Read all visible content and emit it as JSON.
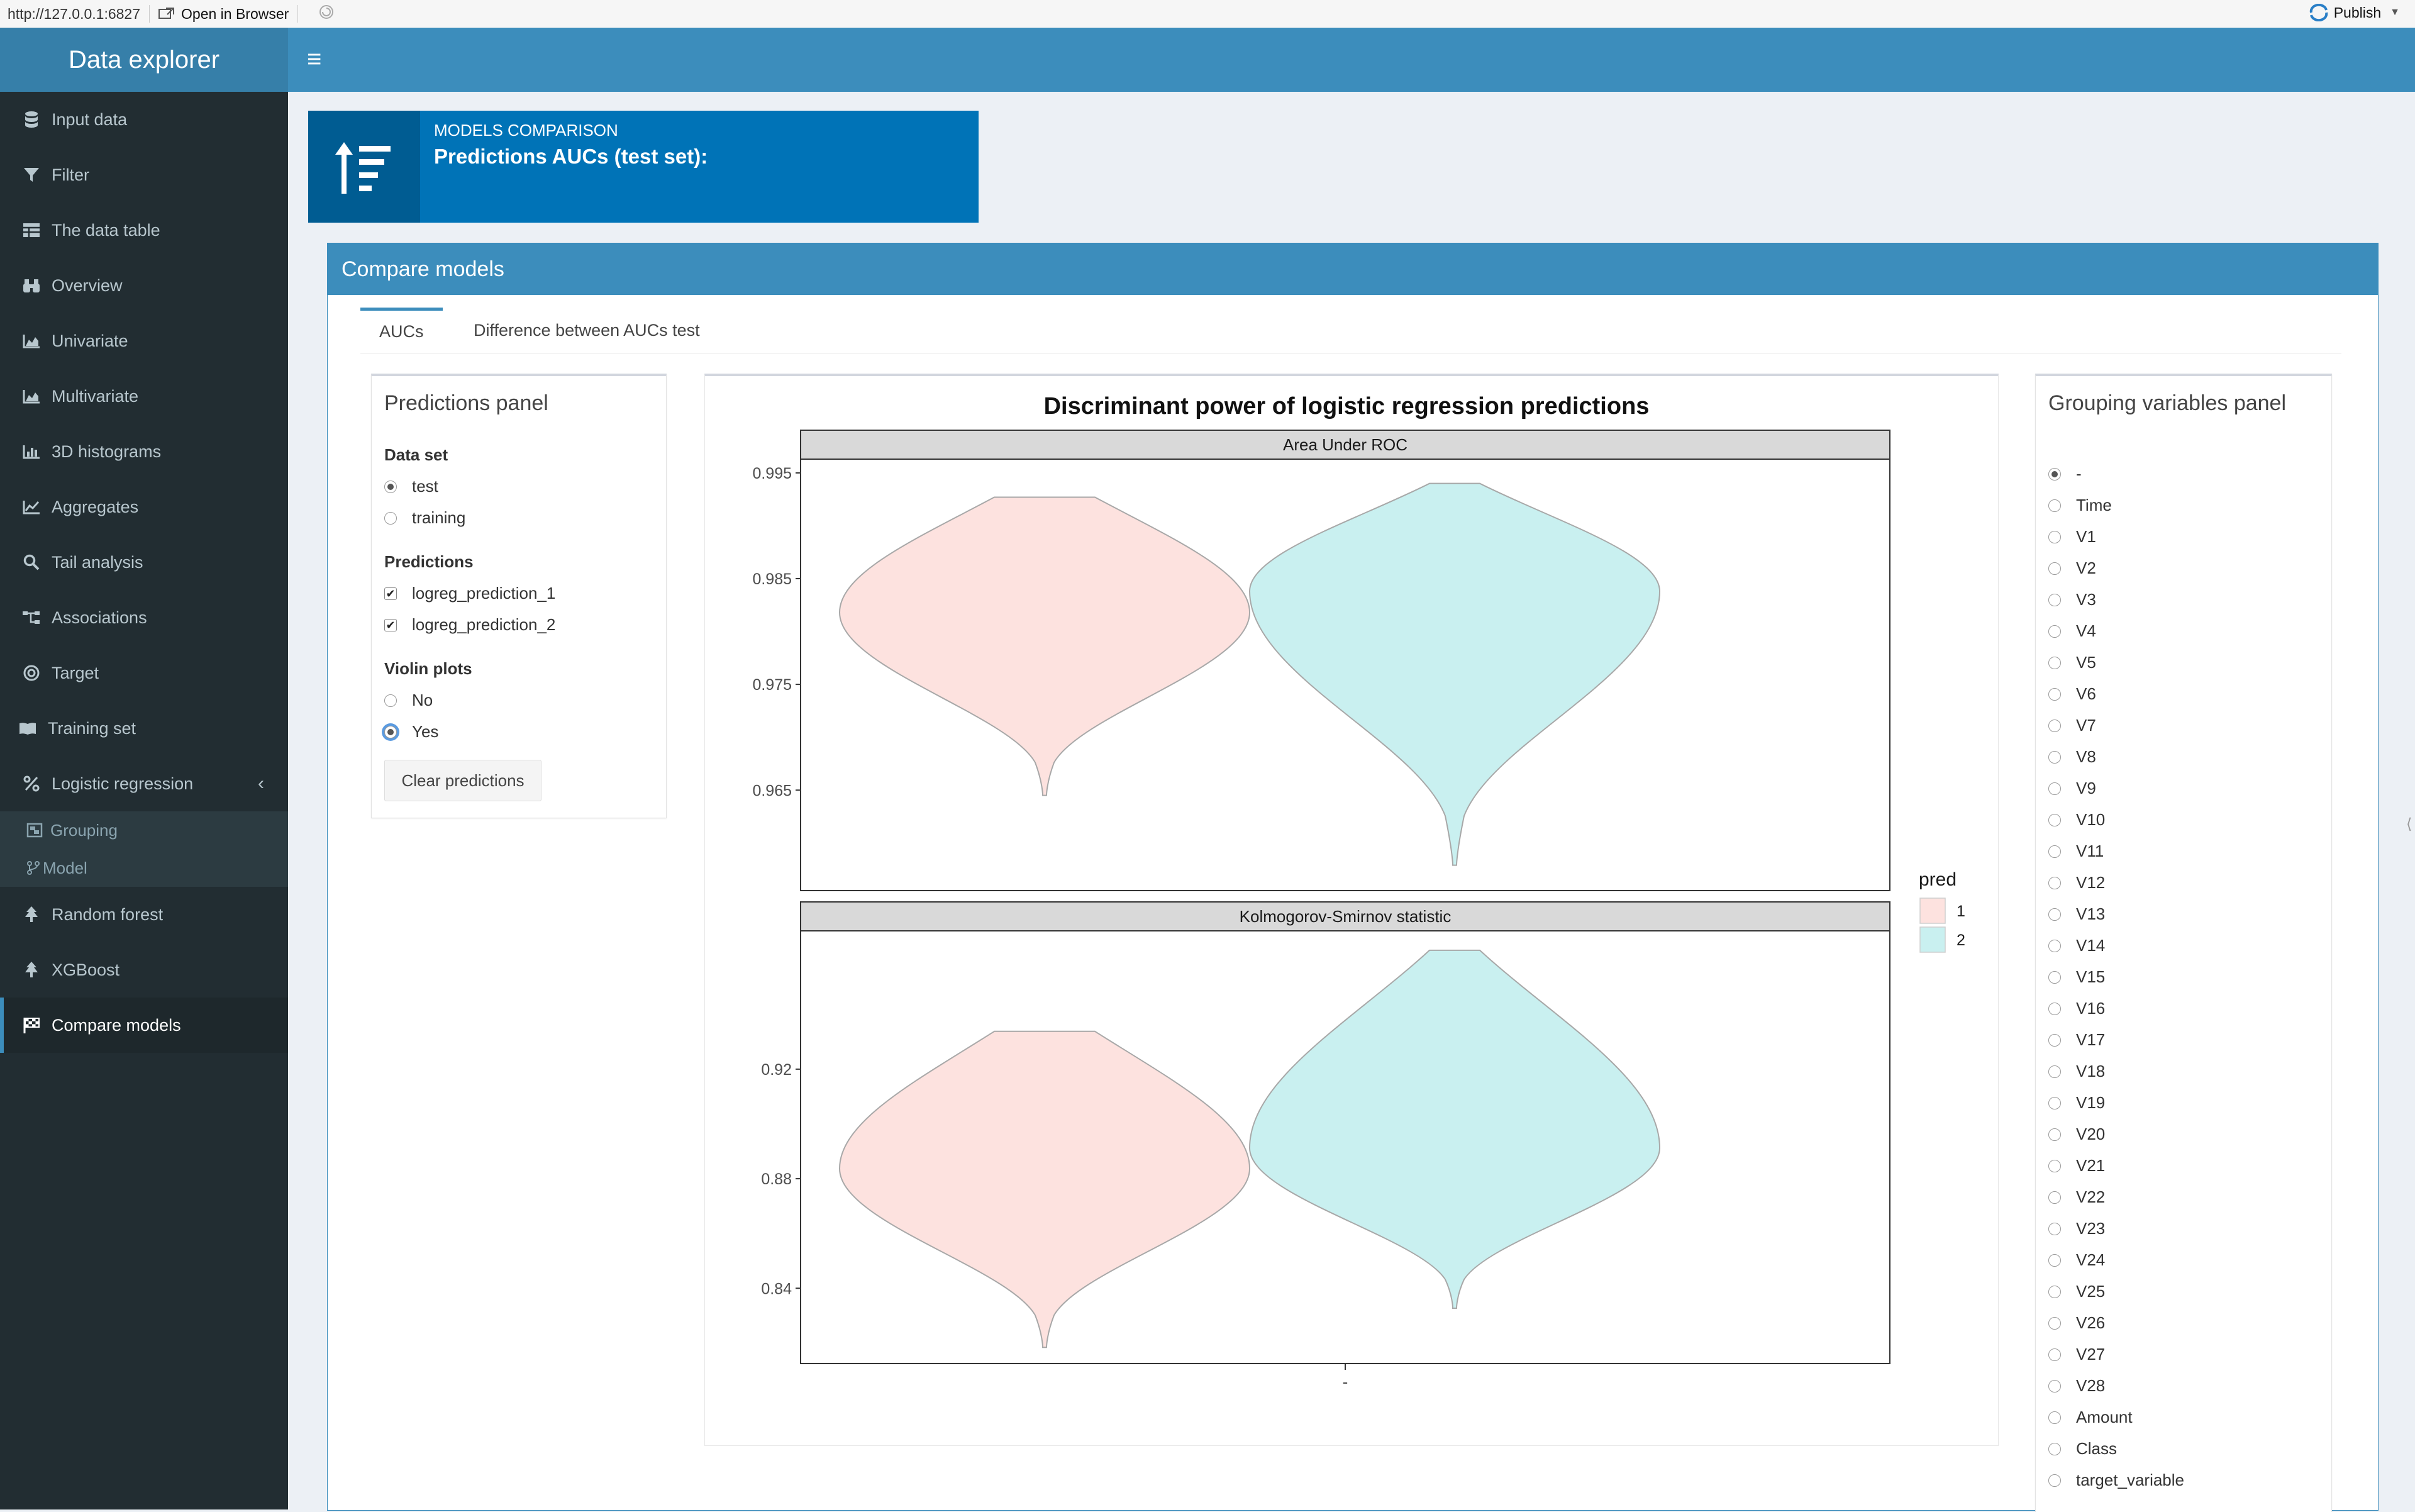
{
  "browser": {
    "url": "http://127.0.0.1:6827",
    "open_in_browser": "Open in Browser",
    "publish": "Publish"
  },
  "app": {
    "title": "Data explorer"
  },
  "sidebar": {
    "items": [
      {
        "label": "Input data",
        "icon": "database-icon"
      },
      {
        "label": "Filter",
        "icon": "filter-icon"
      },
      {
        "label": "The data table",
        "icon": "table-icon"
      },
      {
        "label": "Overview",
        "icon": "binoculars-icon"
      },
      {
        "label": "Univariate",
        "icon": "area-chart-icon"
      },
      {
        "label": "Multivariate",
        "icon": "area-chart-icon"
      },
      {
        "label": "3D histograms",
        "icon": "bar-chart-icon"
      },
      {
        "label": "Aggregates",
        "icon": "line-chart-icon"
      },
      {
        "label": "Tail analysis",
        "icon": "search-icon"
      },
      {
        "label": "Associations",
        "icon": "sitemap-icon"
      },
      {
        "label": "Target",
        "icon": "bullseye-icon"
      },
      {
        "label": "Training set",
        "icon": "book-icon"
      },
      {
        "label": "Logistic regression",
        "icon": "percent-icon"
      },
      {
        "label": "Random forest",
        "icon": "tree-icon"
      },
      {
        "label": "XGBoost",
        "icon": "tree-icon"
      },
      {
        "label": "Compare models",
        "icon": "flag-checkered-icon"
      }
    ],
    "subitems": [
      {
        "label": "Grouping",
        "icon": "object-group-icon"
      },
      {
        "label": "Model",
        "icon": "code-fork-icon"
      }
    ],
    "active": "Compare models"
  },
  "infobox": {
    "subtitle": "MODELS COMPARISON",
    "title": "Predictions AUCs (test set):"
  },
  "mainbox": {
    "title": "Compare models",
    "tabs": [
      "AUCs",
      "Difference between AUCs test"
    ],
    "active_tab": "AUCs"
  },
  "predictions_panel": {
    "title": "Predictions panel",
    "dataset_label": "Data set",
    "dataset_options": [
      "test",
      "training"
    ],
    "dataset_selected": "test",
    "predictions_label": "Predictions",
    "predictions": [
      "logreg_prediction_1",
      "logreg_prediction_2"
    ],
    "violin_label": "Violin plots",
    "violin_options": [
      "No",
      "Yes"
    ],
    "violin_selected": "Yes",
    "clear_button": "Clear predictions"
  },
  "grouping_panel": {
    "title": "Grouping variables panel",
    "options": [
      "-",
      "Time",
      "V1",
      "V2",
      "V3",
      "V4",
      "V5",
      "V6",
      "V7",
      "V8",
      "V9",
      "V10",
      "V11",
      "V12",
      "V13",
      "V14",
      "V15",
      "V16",
      "V17",
      "V18",
      "V19",
      "V20",
      "V21",
      "V22",
      "V23",
      "V24",
      "V25",
      "V26",
      "V27",
      "V28",
      "Amount",
      "Class",
      "target_variable"
    ],
    "selected": "-"
  },
  "chart_data": {
    "type": "violin",
    "title": "Discriminant power of logistic regression predictions",
    "legend_title": "pred",
    "legend_position": "right",
    "x_categories": [
      "-"
    ],
    "series_colors": {
      "1": "#fde2df",
      "2": "#c9f0f0"
    },
    "facets": [
      {
        "name": "Area Under ROC",
        "y_ticks": [
          0.995,
          0.985,
          0.975,
          0.965
        ],
        "series": [
          {
            "name": "1",
            "min": 0.9645,
            "max": 0.9927,
            "widest_at": 0.9818
          },
          {
            "name": "2",
            "min": 0.9579,
            "max": 0.994,
            "widest_at": 0.9838
          }
        ]
      },
      {
        "name": "Kolmogorov-Smirnov statistic",
        "y_ticks": [
          0.92,
          0.88,
          0.84
        ],
        "series": [
          {
            "name": "1",
            "min": 0.8184,
            "max": 0.9338,
            "widest_at": 0.8837
          },
          {
            "name": "2",
            "min": 0.8327,
            "max": 0.9634,
            "widest_at": 0.8912
          }
        ]
      }
    ]
  }
}
